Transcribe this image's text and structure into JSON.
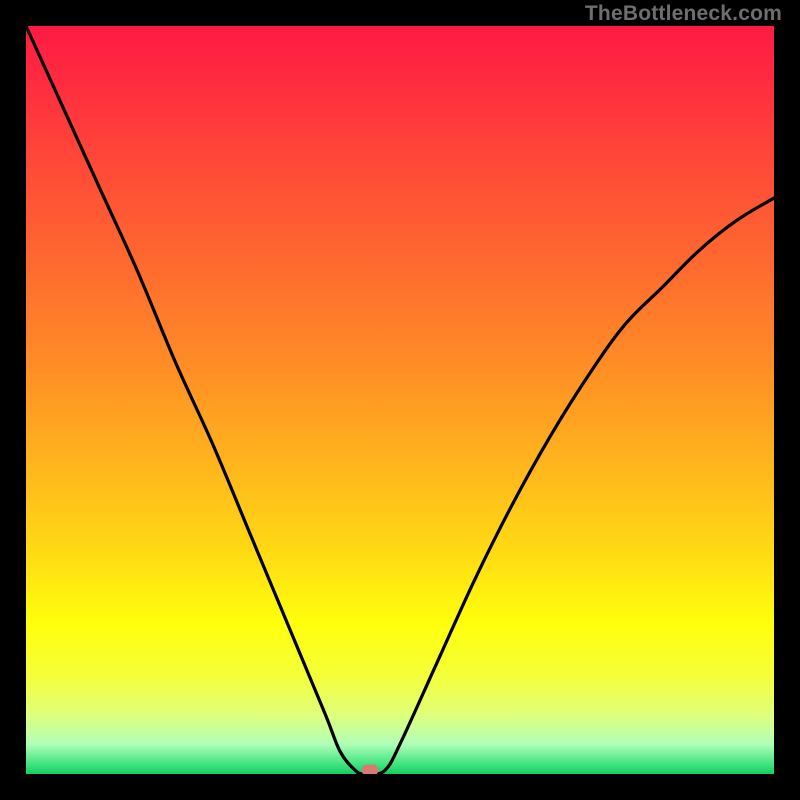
{
  "watermark": "TheBottleneck.com",
  "colors": {
    "frame_bg": "#000000",
    "curve_stroke": "#000000",
    "marker_fill": "#d67a72",
    "gradient_stops": [
      "#ff1a43",
      "#ff2d3f",
      "#ff4838",
      "#ff6a2f",
      "#ff8c26",
      "#ffb31d",
      "#ffd914",
      "#ffff0c",
      "#f4ff3a",
      "#e0ff7a",
      "#b0ffb8",
      "#33e07a",
      "#18c95f"
    ]
  },
  "chart_data": {
    "type": "line",
    "title": "",
    "xlabel": "",
    "ylabel": "",
    "xlim": [
      0,
      100
    ],
    "ylim": [
      0,
      100
    ],
    "grid": false,
    "legend": false,
    "series": [
      {
        "name": "bottleneck-curve",
        "x": [
          0,
          5,
          10,
          15,
          20,
          25,
          30,
          35,
          40,
          42,
          44,
          45,
          46,
          48,
          50,
          55,
          60,
          65,
          70,
          75,
          80,
          85,
          90,
          95,
          100
        ],
        "values": [
          100,
          89,
          78,
          67,
          55,
          44,
          32,
          20,
          8,
          3,
          0.5,
          0,
          0,
          0.5,
          4,
          15,
          26,
          36,
          45,
          53,
          60,
          65,
          70,
          74,
          77
        ]
      }
    ],
    "marker": {
      "x": 46,
      "y": 0
    },
    "flat_segment": {
      "x_start": 42,
      "x_end": 48,
      "y": 0
    },
    "annotations": []
  }
}
